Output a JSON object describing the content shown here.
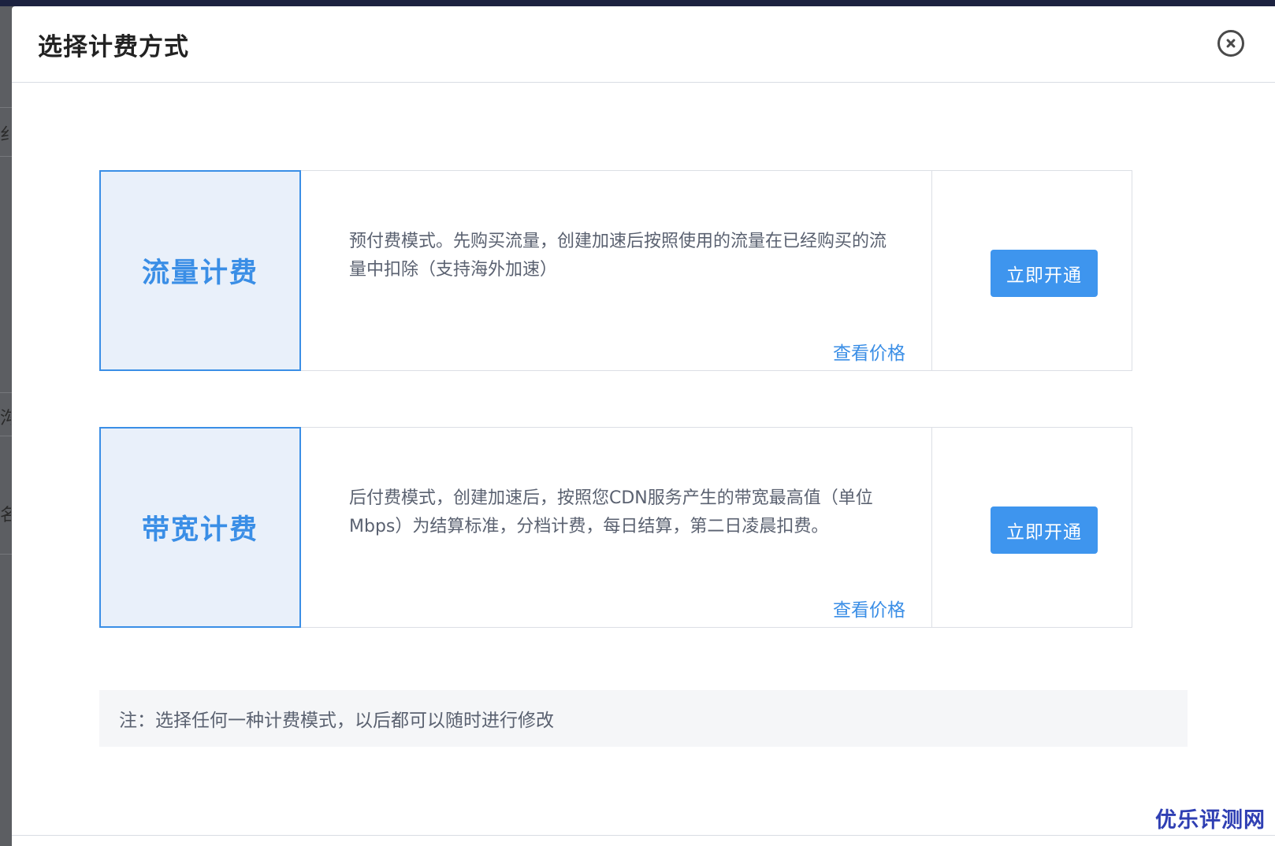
{
  "dialog": {
    "title": "选择计费方式"
  },
  "plans": [
    {
      "name": "流量计费",
      "description": "预付费模式。先购买流量，创建加速后按照使用的流量在已经购买的流量中扣除（支持海外加速）",
      "price_link": "查看价格",
      "action": "立即开通"
    },
    {
      "name": "带宽计费",
      "description": "后付费模式，创建加速后，按照您CDN服务产生的带宽最高值（单位Mbps）为结算标准，分档计费，每日结算，第二日凌晨扣费。",
      "price_link": "查看价格",
      "action": "立即开通"
    }
  ],
  "note": "注：选择任何一种计费模式，以后都可以随时进行修改",
  "background_fragments": [
    "纟",
    "沟",
    "名"
  ],
  "watermark": "优乐评测网",
  "colors": {
    "accent": "#3a8ee6",
    "button": "#3e95ee",
    "plan_box_bg": "#e9f0fa",
    "note_bg": "#f5f6f8"
  },
  "icons": {
    "close": "close-circle-icon"
  }
}
